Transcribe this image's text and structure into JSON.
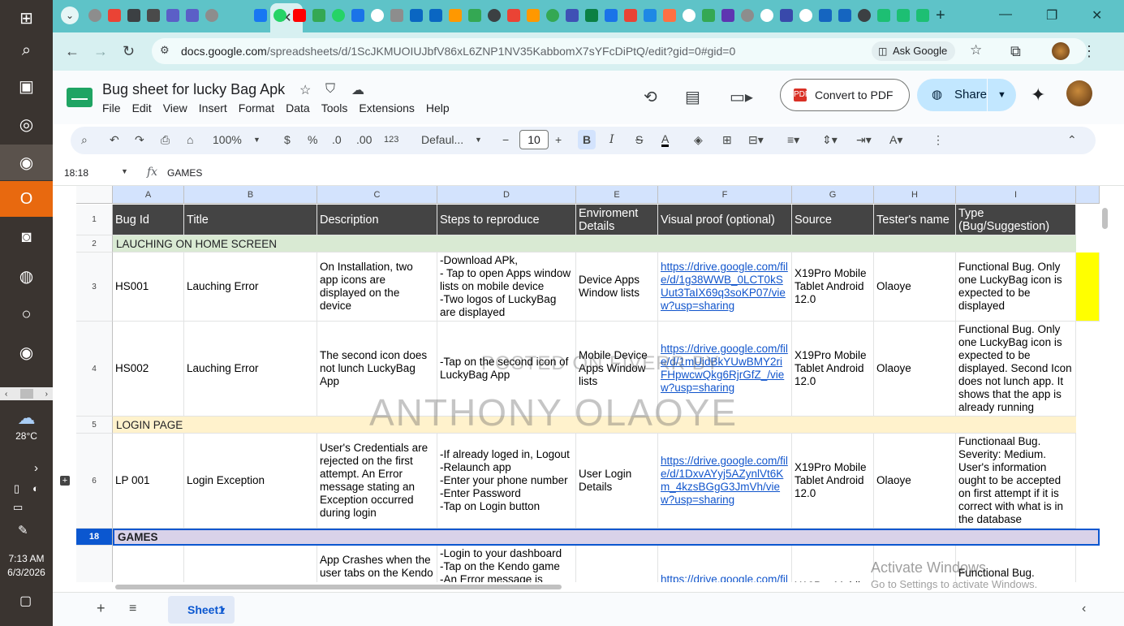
{
  "browser": {
    "url_host": "docs.google.com",
    "url_path": "/spreadsheets/d/1ScJKMUOIUJbfV86xL6ZNP1NV35KabbomX7sYFcDiPtQ/edit?gid=0#gid=0",
    "ask_google": "Ask Google",
    "tab_close": "✕",
    "new_tab": "+"
  },
  "sheets": {
    "title": "Bug sheet for lucky Bag Apk",
    "menu": [
      "File",
      "Edit",
      "View",
      "Insert",
      "Format",
      "Data",
      "Tools",
      "Extensions",
      "Help"
    ],
    "convert_pdf": "Convert to PDF",
    "pdf_icon_label": "PDF",
    "share": "Share"
  },
  "toolbar": {
    "zoom": "100%",
    "currency": "$",
    "percent": "%",
    "dec_less": ".0",
    "dec_more": ".00",
    "number_format": "123",
    "font": "Defaul...",
    "font_size": "10",
    "bold": "B",
    "italic": "I",
    "strike": "S",
    "text_color": "A"
  },
  "formula_bar": {
    "name_box": "18:18",
    "fx": "fx",
    "content": "GAMES"
  },
  "columns": [
    "A",
    "B",
    "C",
    "D",
    "E",
    "F",
    "G",
    "H",
    "I"
  ],
  "rows": {
    "header": {
      "num": "1",
      "cells": [
        "Bug Id",
        "Title",
        "Description",
        "Steps to reproduce",
        "Enviroment Details",
        "Visual proof (optional)",
        "Source",
        "Tester's name",
        "Type (Bug/Suggestion)"
      ]
    },
    "r2": {
      "num": "2",
      "label": "LAUCHING ON HOME SCREEN"
    },
    "r3": {
      "num": "3",
      "cells": [
        "HS001",
        "Lauching Error",
        "On Installation, two app icons are displayed on the device",
        "-Download APk,\n- Tap to open  Apps window lists on mobile device\n-Two logos of LuckyBag are displayed",
        "Device Apps Window lists",
        "https://drive.google.com/file/d/1g38WWB_0LCT0kSUut3TaIX69q3soKP07/view?usp=sharing",
        "X19Pro Mobile Tablet Android 12.0",
        "Olaoye",
        "Functional Bug. Only one LuckyBag icon is expected to be displayed"
      ]
    },
    "r4": {
      "num": "4",
      "cells": [
        "HS002",
        "Lauching Error",
        "The second icon does not lunch LuckyBag App",
        "-Tap on the second icon of LuckyBag App",
        "Mobile Device Apps Window lists",
        "https://drive.google.com/file/d/1mUidBkYUwBMY2riFHpwcwQkg6RjrGfZ_/view?usp=sharing",
        "X19Pro Mobile Tablet Android 12.0",
        "Olaoye",
        "Functional Bug. Only one LuckyBag icon is expected to be displayed. Second Icon does not lunch app. It shows that the app is already running"
      ]
    },
    "r5": {
      "num": "5",
      "label": "LOGIN PAGE"
    },
    "r6": {
      "num": "6",
      "cells": [
        "LP 001",
        "Login Exception",
        "User's Credentials are rejected on the first attempt. An Error message stating an Exception occurred during login",
        "-If already loged in, Logout\n-Relaunch app\n-Enter your phone number\n-Enter Password\n-Tap on Login button",
        "User Login Details",
        "https://drive.google.com/file/d/1DxvAYyj5AZynlVt6Km_4kzsBGgG3JmVh/view?usp=sharing",
        "X19Pro Mobile Tablet Android 12.0",
        "Olaoye",
        "Functionaal Bug. Severity: Medium. User's information ought to be accepted on first attempt if it is correct with what is in the database"
      ]
    },
    "r18": {
      "num": "18",
      "label": "GAMES"
    },
    "r19": {
      "cells": [
        "",
        "",
        "App Crashes when the user tabs on the Kendo",
        "-Login to your dashboard\n-Tap on the Kendo game\n-An Error message is",
        "",
        "https://drive.google.com/fil",
        "X19Pro Mobile",
        "",
        "Functional Bug."
      ]
    }
  },
  "watermark": {
    "posted": "POSTED ON FIVERR BY",
    "name": "ANTHONY OLAOYE"
  },
  "activate": {
    "title": "Activate Windows",
    "sub": "Go to Settings to activate Windows."
  },
  "sheet_tabs": {
    "active": "Sheet1"
  },
  "taskbar": {
    "weather": "28°C",
    "time": "7:13 AM",
    "date": "6/3/2026"
  },
  "colors": {
    "header_row": "#444444",
    "launch_band": "#d9ead3",
    "login_band": "#fff2cc",
    "games_band": "#d9d2e9",
    "highlight": "#ffff00",
    "accent": "#0b57d0"
  }
}
